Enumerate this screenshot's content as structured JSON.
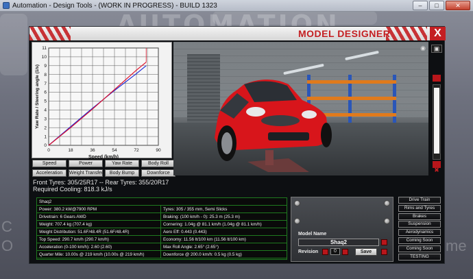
{
  "window": {
    "title": "Automation - Design Tools - (WORK IN PROGRESS) - BUILD 1323"
  },
  "background": {
    "logo": "AUTOMATION",
    "side_letter_1": "C",
    "side_letter_2": "O",
    "side_word": "me"
  },
  "designer": {
    "title": "MODEL DESIGNER",
    "close_label": "X"
  },
  "chart_data": {
    "type": "line",
    "xlabel": "Speed (km/h)",
    "ylabel": "Yaw Rate / Steering angle (1/s)",
    "x_ticks": [
      0,
      18,
      36,
      54,
      72,
      90
    ],
    "y_ticks": [
      0,
      1,
      2,
      3,
      4,
      5,
      6,
      7,
      8,
      9,
      10,
      11
    ],
    "xlim": [
      0,
      90
    ],
    "ylim": [
      0,
      11
    ],
    "grid": true,
    "series": [
      {
        "color": "#1f2bd6",
        "x": [
          0,
          18,
          36,
          54,
          72,
          80
        ],
        "y": [
          0,
          2.1,
          4.2,
          6.2,
          8.1,
          9.0
        ]
      },
      {
        "color": "#e0112a",
        "x": [
          0,
          18,
          36,
          54,
          72,
          80
        ],
        "y": [
          0,
          2.0,
          4.1,
          6.3,
          8.5,
          9.4
        ]
      }
    ],
    "vertical_marker": {
      "x": 80,
      "color": "#e0112a"
    }
  },
  "chart_buttons": [
    "Speed",
    "Power",
    "Yaw Rate",
    "Body Roll",
    "Acceleration",
    "Weight Transfer",
    "Body Bump",
    "Downforce"
  ],
  "tyres": {
    "line": "Front Tyres: 305/25R17 -- Rear Tyres: 355/20R17",
    "cooling": "Required Cooling: 818.3 kJ/s"
  },
  "stats": {
    "model": "Shaq2",
    "rows": [
      [
        "Power: 380.2 kW@7900 RPM",
        "Tyres: 305 / 355 mm, Semi Slicks"
      ],
      [
        "Drivetrain: 6 Gears AWD",
        "Braking: (100 km/h - 0): 25.3 m (25.3 m)"
      ],
      [
        "Weight: 707.4 kg (707.4 kg)",
        "Cornering: 1.04g @ 81.1 km/h (1.04g @ 81.1 km/h)"
      ],
      [
        "Weight Distribution: 51.6F/48.4R (51.6F/48.4R)",
        "Aero Eff: 0.443 (0.443)"
      ],
      [
        "Top Speed: 290.7 km/h (290.7 km/h)",
        "Economy: 11.56 lt/100 km (11.56 lt/100 km)"
      ],
      [
        "Acceleration (0-100 km/h): 2.60 (2.60)",
        "Max Roll Angle: 2.65° (2.65°)"
      ],
      [
        "Quarter Mile: 10.00s @ 219 km/h (10.00s @ 219 km/h)",
        "Downforce @ 200.0 km/h: 0.5 kg (0.5 kg)"
      ]
    ]
  },
  "model_panel": {
    "name_label": "Model Name",
    "name_value": "Shaq2",
    "revision_label": "Revision",
    "revision_value": "0",
    "save_label": "Save"
  },
  "nav_buttons": [
    "Drive Train",
    "Rims and Tyres",
    "Brakes",
    "Suspension",
    "Aerodynamics",
    "Coming Soon",
    "Coming Soon",
    "TESTING"
  ]
}
